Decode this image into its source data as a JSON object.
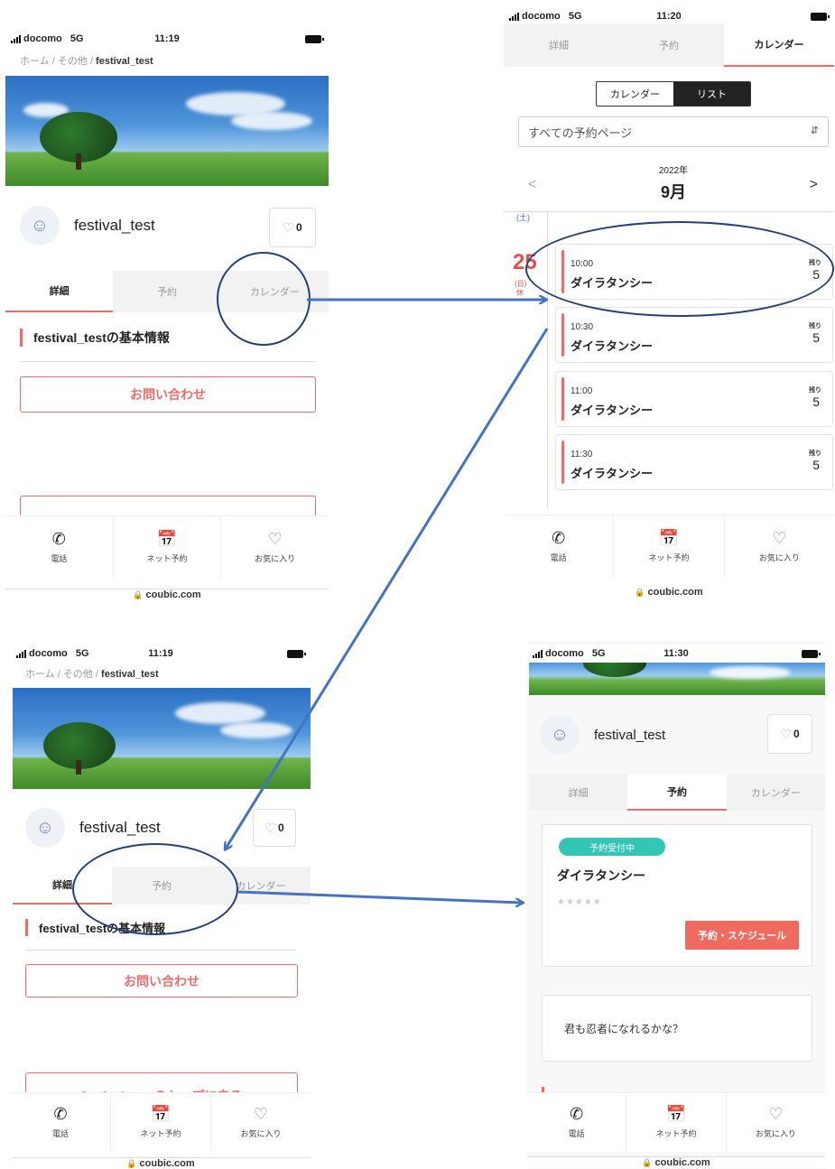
{
  "status": {
    "carrier": "docomo",
    "network": "5G",
    "times": [
      "11:19",
      "11:20",
      "11:19",
      "11:30"
    ]
  },
  "breadcrumb": {
    "home": "ホーム",
    "sep": "/",
    "other": "その他",
    "current": "festival_test"
  },
  "shop": {
    "name": "festival_test",
    "favorites": "0"
  },
  "tabs": {
    "details": "詳細",
    "booking": "予約",
    "calendar": "カレンダー"
  },
  "details": {
    "section_title": "festival_testの基本情報",
    "contact_button": "お問い合わせ",
    "back_to_top_button": "festival_testのトップに戻る"
  },
  "bottom_nav": {
    "phone": "電話",
    "net_booking": "ネット予約",
    "favorite": "お気に入り"
  },
  "url": "coubic.com",
  "calendar": {
    "toggle": {
      "calendar": "カレンダー",
      "list": "リスト"
    },
    "page_select": "すべての予約ページ",
    "year": "2022年",
    "month": "9月",
    "prev": "<",
    "next": ">",
    "prev_day_label": "(土)",
    "day": {
      "number": "25",
      "weekday": "(日)",
      "note": "休"
    },
    "remaining_label": "残り",
    "slots": [
      {
        "time": "10:00",
        "name": "ダイラタンシー",
        "remaining": "5"
      },
      {
        "time": "10:30",
        "name": "ダイラタンシー",
        "remaining": "5"
      },
      {
        "time": "11:00",
        "name": "ダイラタンシー",
        "remaining": "5"
      },
      {
        "time": "11:30",
        "name": "ダイラタンシー",
        "remaining": "5"
      }
    ]
  },
  "booking": {
    "badge": "予約受付中",
    "menu_name": "ダイラタンシー",
    "stars": "★★★★★",
    "schedule_button": "予約・スケジュール",
    "description": "君も忍者になれるかな？"
  },
  "colors": {
    "accent": "#ee6b6b",
    "annotation": "#22407a",
    "arrow": "#4472c4",
    "badge": "#33c6b4"
  },
  "icons": [
    "phone-icon",
    "calendar-check-icon",
    "heart-icon",
    "lock-icon",
    "user-icon"
  ]
}
